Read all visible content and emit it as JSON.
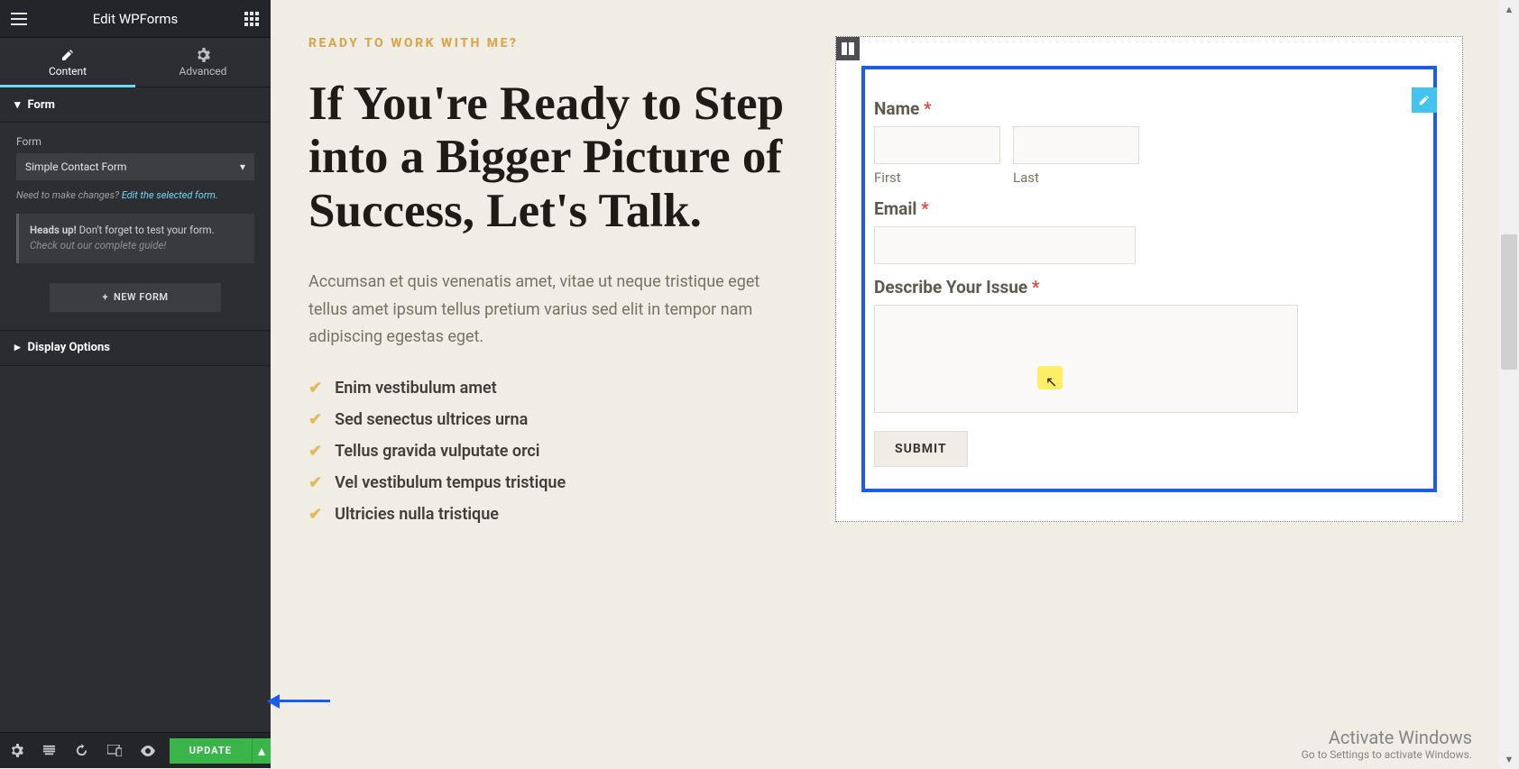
{
  "header": {
    "title": "Edit WPForms"
  },
  "tabs": {
    "content": "Content",
    "advanced": "Advanced"
  },
  "sections": {
    "form": "Form",
    "display": "Display Options"
  },
  "formField": {
    "label": "Form",
    "selected": "Simple Contact Form"
  },
  "helper": {
    "prefix": "Need to make changes? ",
    "link": "Edit the selected form."
  },
  "notice": {
    "bold": "Heads up!",
    "rest": " Don't forget to test your form.",
    "italic": "Check out our complete guide!"
  },
  "newFormBtn": "NEW FORM",
  "footer": {
    "update": "UPDATE"
  },
  "page": {
    "eyebrow": "READY TO WORK WITH ME?",
    "headline": "If You're Ready to Step into a Bigger Picture of Success, Let's Talk.",
    "para": "Accumsan et quis venenatis amet, vitae ut neque tristique eget tellus amet ipsum tellus pretium varius sed elit in tempor nam adipiscing egestas eget.",
    "checks": [
      "Enim vestibulum amet",
      "Sed senectus ultrices urna",
      "Tellus gravida vulputate orci",
      "Vel vestibulum tempus tristique",
      "Ultricies nulla tristique"
    ]
  },
  "form": {
    "name": "Name",
    "first": "First",
    "last": "Last",
    "email": "Email",
    "desc": "Describe Your Issue",
    "submit": "SUBMIT"
  },
  "watermark": {
    "l1": "Activate Windows",
    "l2": "Go to Settings to activate Windows."
  }
}
